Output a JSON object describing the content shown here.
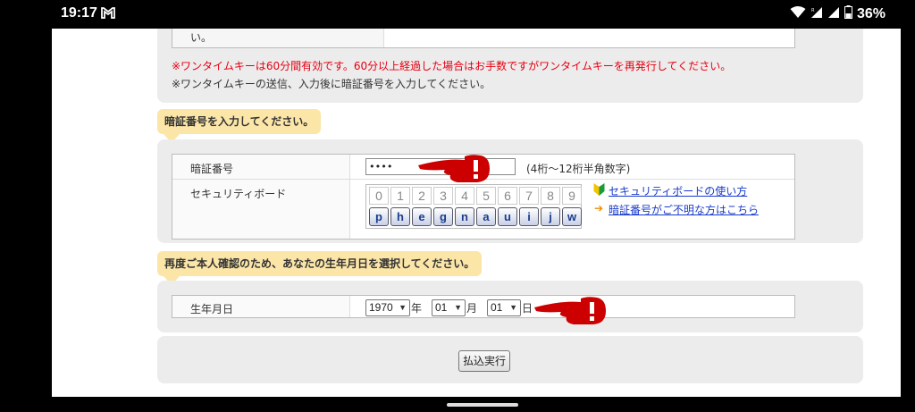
{
  "status_bar": {
    "time": "19:17",
    "notification_icon": "gmail-icon",
    "battery_text": "36%"
  },
  "top_section": {
    "cell_text": "い。",
    "notice_red": "※ワンタイムキーは60分間有効です。60分以上経過した場合はお手数ですがワンタイムキーを再発行してください。",
    "notice_gray": "※ワンタイムキーの送信、入力後に暗証番号を入力してください。"
  },
  "pin_section": {
    "heading": "暗証番号を入力してください。",
    "pin_label": "暗証番号",
    "pin_value": "••••",
    "pin_hint": "(4桁〜12桁半角数字)",
    "security_board_label": "セキュリティボード",
    "digits": [
      "0",
      "1",
      "2",
      "3",
      "4",
      "5",
      "6",
      "7",
      "8",
      "9"
    ],
    "keys": [
      "p",
      "h",
      "e",
      "g",
      "n",
      "a",
      "u",
      "i",
      "j",
      "w"
    ],
    "help_link_usage": "セキュリティボードの使い方",
    "help_link_forgot": "暗証番号がご不明な方はこちら"
  },
  "dob_section": {
    "heading": "再度ご本人確認のため、あなたの生年月日を選択してください。",
    "label": "生年月日",
    "year_value": "1970",
    "year_unit": "年",
    "month_value": "01",
    "month_unit": "月",
    "day_value": "01",
    "day_unit": "日"
  },
  "submit": {
    "label": "払込実行"
  },
  "colors": {
    "accent_red": "#e60012",
    "link_blue": "#1a3ccc",
    "heading_bg": "#fbe6a8",
    "pointer_red": "#cc0000"
  }
}
